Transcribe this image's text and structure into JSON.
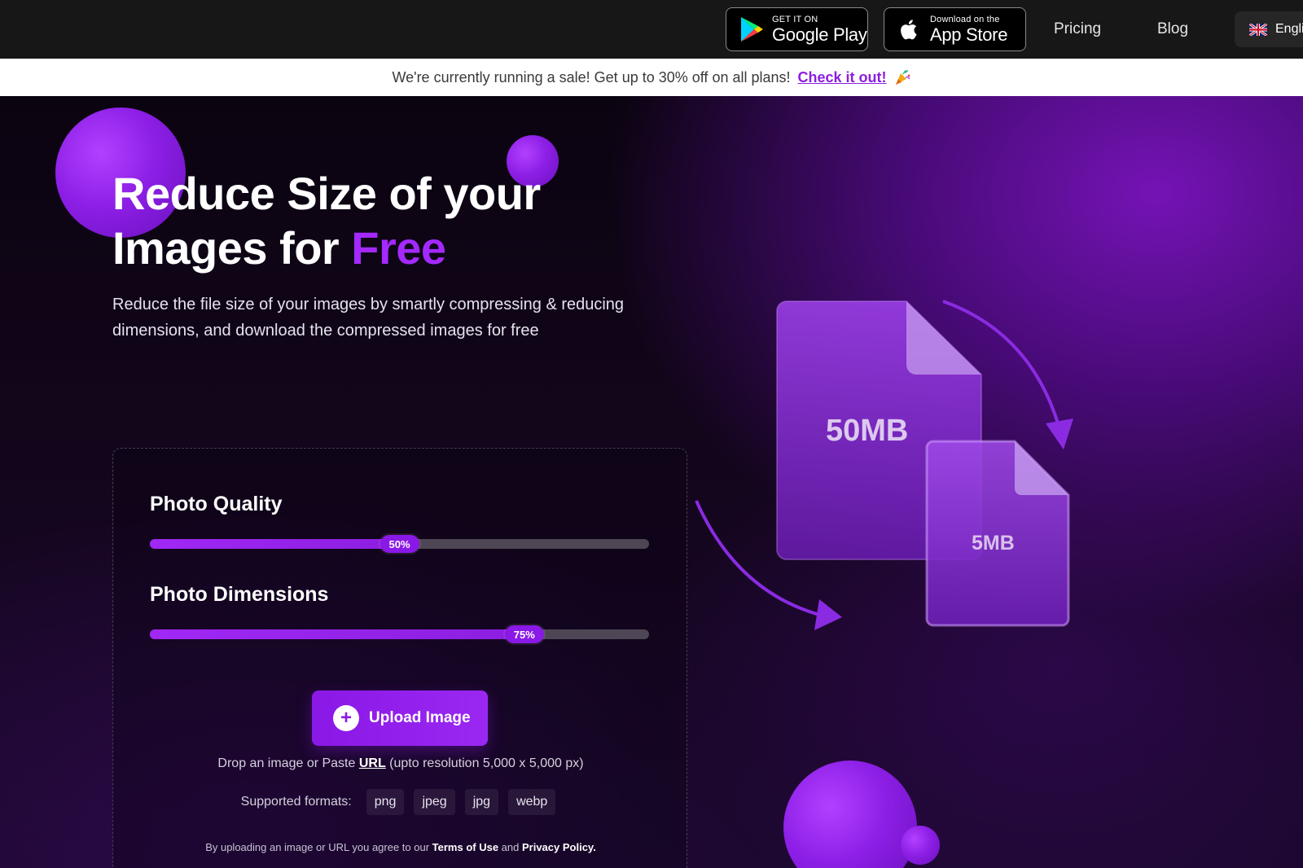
{
  "nav": {
    "google_play_small": "GET IT ON",
    "google_play_big": "Google Play",
    "app_store_small": "Download on the",
    "app_store_big": "App Store",
    "pricing": "Pricing",
    "blog": "Blog",
    "language": "Engli"
  },
  "banner": {
    "text": "We're currently running a sale! Get up to 30% off on all plans!",
    "cta": "Check it out!"
  },
  "hero": {
    "title_line1": "Reduce Size of your",
    "title_line2_prefix": "Images for ",
    "title_highlight": "Free",
    "lead": "Reduce the file size of your images by smartly compressing & reducing dimensions, and download the compressed images for free"
  },
  "controls": {
    "quality_label": "Photo Quality",
    "quality_value": 50,
    "quality_text": "50%",
    "dimensions_label": "Photo Dimensions",
    "dimensions_value": 75,
    "dimensions_text": "75%",
    "upload_label": "Upload Image",
    "drop_prefix": "Drop an image or Paste ",
    "drop_url": "URL",
    "drop_suffix": " (upto resolution 5,000 x 5,000 px)",
    "formats_label": "Supported formats:",
    "formats": [
      "png",
      "jpeg",
      "jpg",
      "webp"
    ],
    "legal_prefix": "By uploading an image or URL you agree to our ",
    "terms": "Terms of Use",
    "legal_and": " and ",
    "privacy": "Privacy Policy."
  },
  "illustration": {
    "big_size": "50MB",
    "small_size": "5MB"
  },
  "colors": {
    "accent": "#a429ff",
    "button": "#8a18e6",
    "nav_bg": "#171717"
  }
}
